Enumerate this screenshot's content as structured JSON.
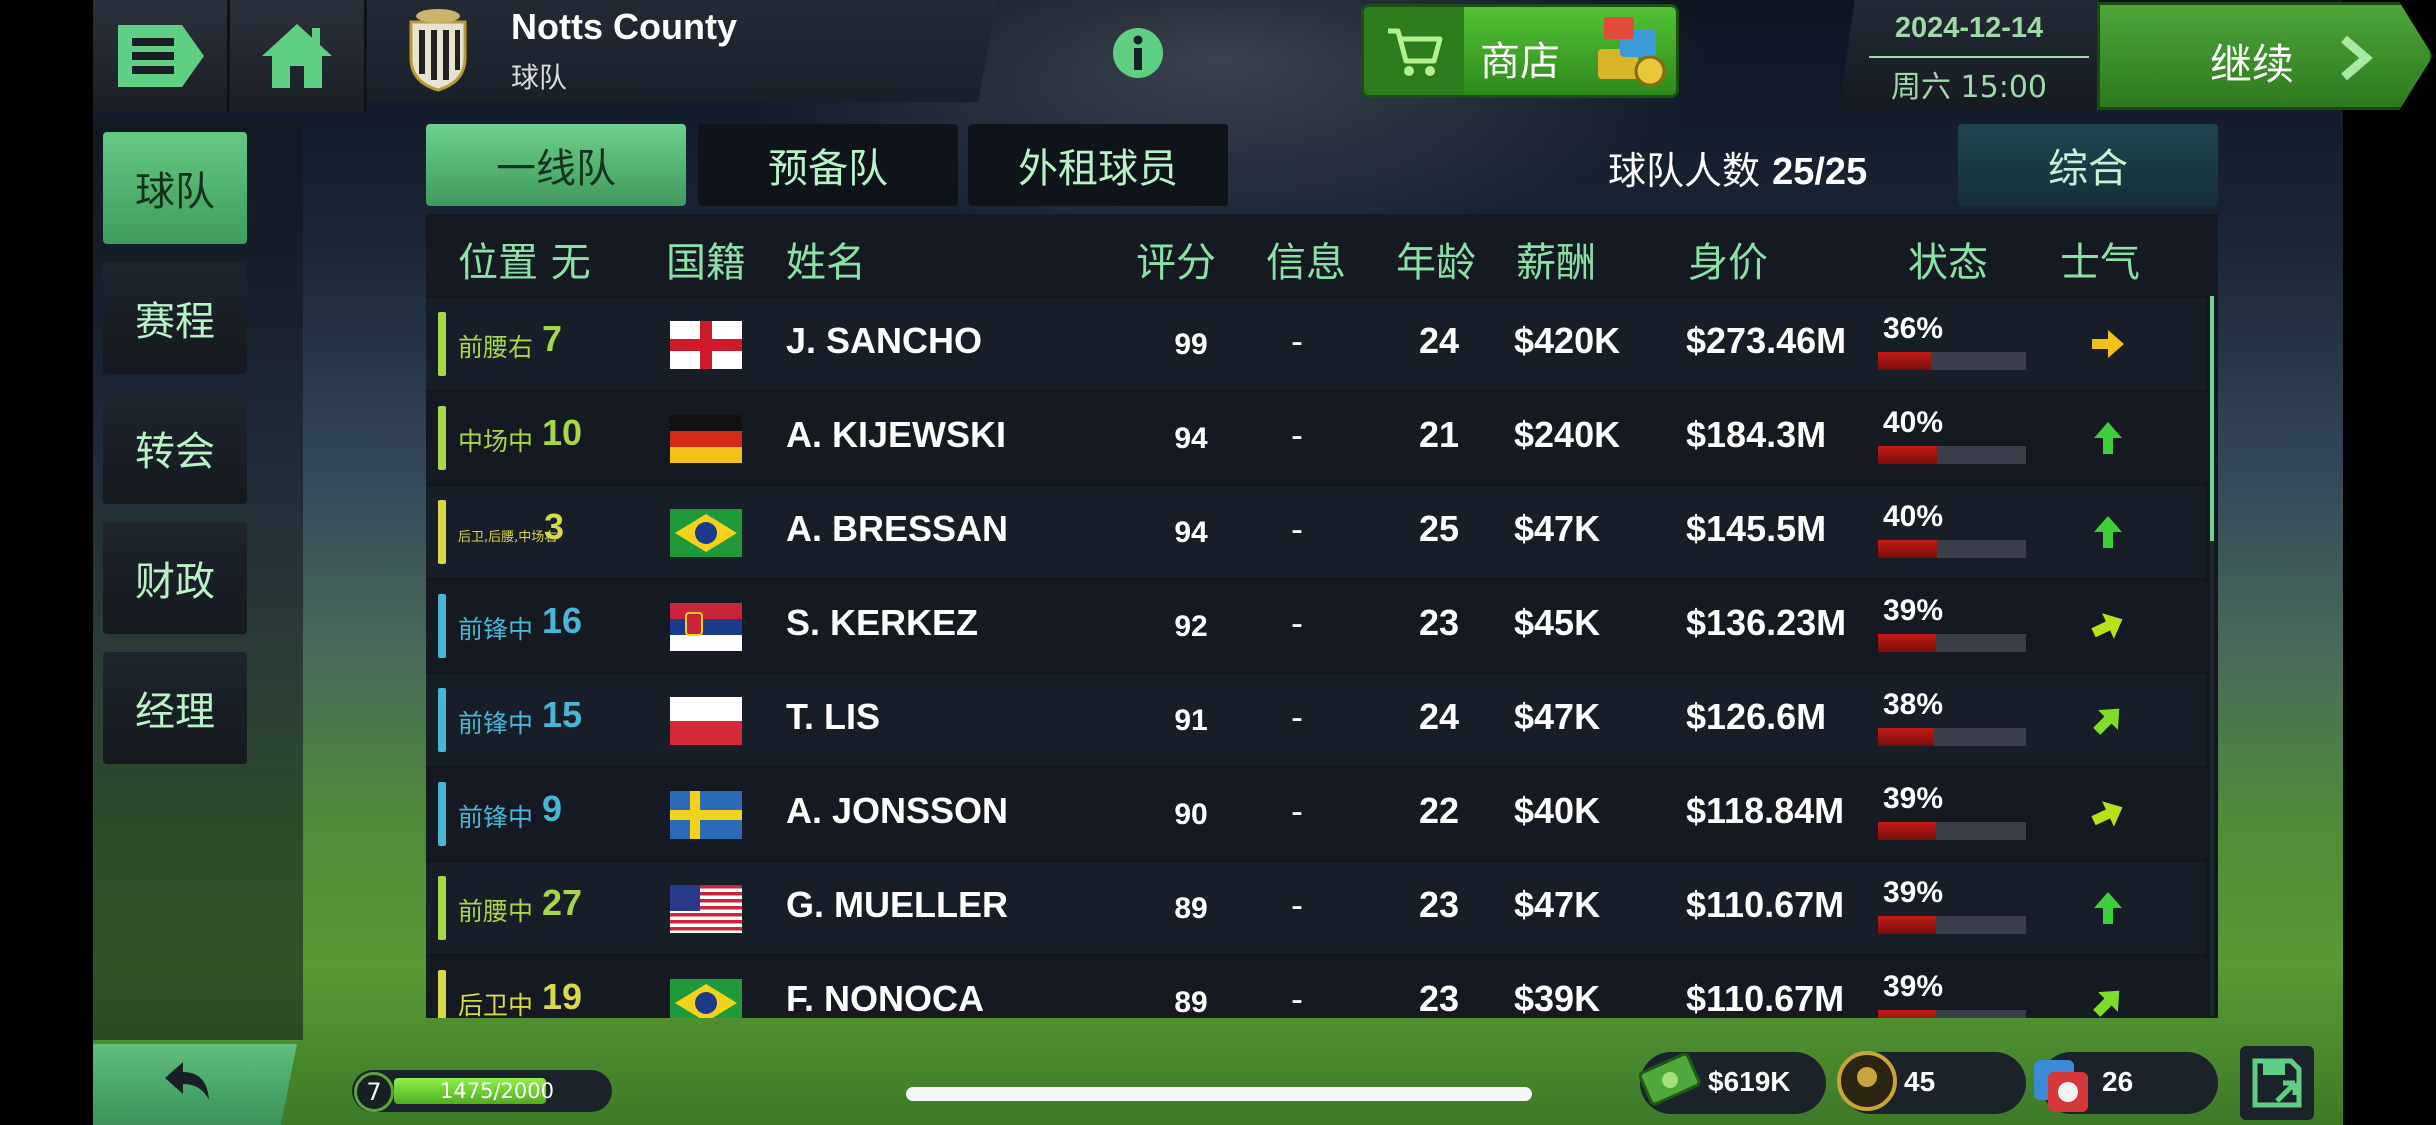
{
  "header": {
    "club_name": "Notts County",
    "club_subtitle": "球队",
    "shop_label": "商店",
    "date": "2024-12-14",
    "day_time": "周六 15:00",
    "continue_label": "继续"
  },
  "sidebar": {
    "items": [
      {
        "label": "球队",
        "active": true
      },
      {
        "label": "赛程",
        "active": false
      },
      {
        "label": "转会",
        "active": false
      },
      {
        "label": "财政",
        "active": false
      },
      {
        "label": "经理",
        "active": false
      }
    ]
  },
  "tabs": [
    {
      "label": "一线队",
      "active": true
    },
    {
      "label": "预备队",
      "active": false
    },
    {
      "label": "外租球员",
      "active": false
    }
  ],
  "squad_count_label": "球队人数",
  "squad_count": "25/25",
  "view_mode_label": "综合",
  "table": {
    "headers": {
      "position": "位置 无",
      "nationality": "国籍",
      "name": "姓名",
      "rating": "评分",
      "info": "信息",
      "age": "年龄",
      "wage": "薪酬",
      "value": "身价",
      "condition": "状态",
      "morale": "士气"
    },
    "rows": [
      {
        "position": "前腰右",
        "number": "7",
        "pos_color": "#a6d64a",
        "flag": "england",
        "name": "J. SANCHO",
        "rating": "99",
        "info": "-",
        "age": "24",
        "wage": "$420K",
        "value": "$273.46M",
        "condition": "36%",
        "condition_level": 0.36,
        "morale": "right",
        "morale_color": "#f2c21b"
      },
      {
        "position": "中场中",
        "number": "10",
        "pos_color": "#a6d64a",
        "flag": "germany",
        "name": "A. KIJEWSKI",
        "rating": "94",
        "info": "-",
        "age": "21",
        "wage": "$240K",
        "value": "$184.3M",
        "condition": "40%",
        "condition_level": 0.4,
        "morale": "up",
        "morale_color": "#3fcf3a"
      },
      {
        "position": "后卫,后腰,中场右",
        "number": "3",
        "pos_color": "#d8d84a",
        "flag": "brazil",
        "name": "A. BRESSAN",
        "rating": "94",
        "info": "-",
        "age": "25",
        "wage": "$47K",
        "value": "$145.5M",
        "condition": "40%",
        "condition_level": 0.4,
        "morale": "up",
        "morale_color": "#3fcf3a"
      },
      {
        "position": "前锋中",
        "number": "16",
        "pos_color": "#4ab6d6",
        "flag": "serbia",
        "name": "S. KERKEZ",
        "rating": "92",
        "info": "-",
        "age": "23",
        "wage": "$45K",
        "value": "$136.23M",
        "condition": "39%",
        "condition_level": 0.39,
        "morale": "up-right-slight",
        "morale_color": "#b6e21b"
      },
      {
        "position": "前锋中",
        "number": "15",
        "pos_color": "#4ab6d6",
        "flag": "poland",
        "name": "T. LIS",
        "rating": "91",
        "info": "-",
        "age": "24",
        "wage": "$47K",
        "value": "$126.6M",
        "condition": "38%",
        "condition_level": 0.38,
        "morale": "up-right",
        "morale_color": "#7fdc2a"
      },
      {
        "position": "前锋中",
        "number": "9",
        "pos_color": "#4ab6d6",
        "flag": "sweden",
        "name": "A. JONSSON",
        "rating": "90",
        "info": "-",
        "age": "22",
        "wage": "$40K",
        "value": "$118.84M",
        "condition": "39%",
        "condition_level": 0.39,
        "morale": "up-right-slight",
        "morale_color": "#b6e21b"
      },
      {
        "position": "前腰中",
        "number": "27",
        "pos_color": "#a6d64a",
        "flag": "usa",
        "name": "G. MUELLER",
        "rating": "89",
        "info": "-",
        "age": "23",
        "wage": "$47K",
        "value": "$110.67M",
        "condition": "39%",
        "condition_level": 0.39,
        "morale": "up",
        "morale_color": "#3fcf3a"
      },
      {
        "position": "后卫中",
        "number": "19",
        "pos_color": "#d8d84a",
        "flag": "brazil",
        "name": "F. NONOCA",
        "rating": "89",
        "info": "-",
        "age": "23",
        "wage": "$39K",
        "value": "$110.67M",
        "condition": "39%",
        "condition_level": 0.39,
        "morale": "up-right",
        "morale_color": "#7fdc2a"
      }
    ]
  },
  "footer": {
    "level": "7",
    "xp": "1475/2000",
    "xp_fraction": 0.7375,
    "cash": "$619K",
    "coins": "45",
    "tokens": "26"
  },
  "colors": {
    "accent_green": "#6fcf8c",
    "header_text": "#8be0a6",
    "condition_red": "#c21b14"
  },
  "icons": [
    "menu-icon",
    "home-icon",
    "info-icon",
    "cart-icon",
    "chevron-right-icon",
    "back-arrow-icon",
    "cash-icon",
    "coin-icon",
    "token-icon",
    "save-icon"
  ]
}
